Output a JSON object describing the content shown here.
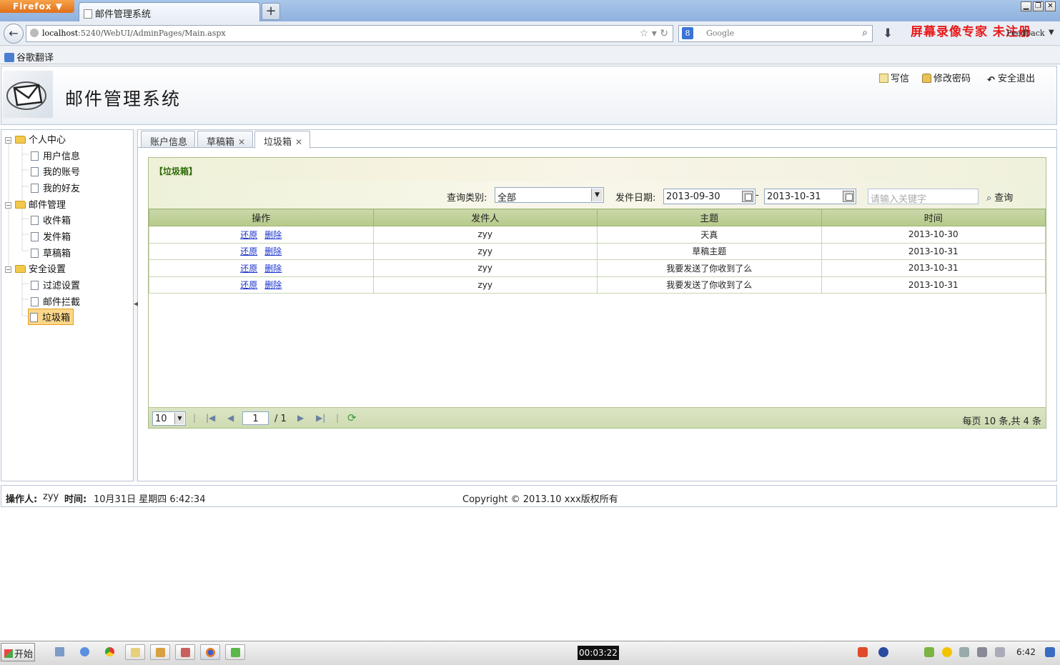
{
  "browser": {
    "menu_button": "Firefox ▼",
    "tab_title": "邮件管理系统",
    "new_tab": "+",
    "url_host": "localhost",
    "url_rest": ":5240/WebUI/AdminPages/Main.aspx",
    "search_placeholder": "Google",
    "feedback": "Feedback",
    "watermark": "屏幕录像专家 未注册",
    "bookmark": "谷歌翻译"
  },
  "app": {
    "title": "邮件管理系统",
    "links": {
      "write": "写信",
      "change_password": "修改密码",
      "logout": "安全退出"
    }
  },
  "sidebar": {
    "groups": [
      {
        "label": "个人中心",
        "items": [
          "用户信息",
          "我的账号",
          "我的好友"
        ]
      },
      {
        "label": "邮件管理",
        "items": [
          "收件箱",
          "发件箱",
          "草稿箱"
        ]
      },
      {
        "label": "安全设置",
        "items": [
          "过滤设置",
          "邮件拦截",
          "垃圾箱"
        ]
      }
    ],
    "selected": "垃圾箱"
  },
  "tabs": [
    {
      "label": "账户信息",
      "closable": false
    },
    {
      "label": "草稿箱",
      "closable": true
    },
    {
      "label": "垃圾箱",
      "closable": true,
      "active": true
    }
  ],
  "panel": {
    "title": "【垃圾箱】",
    "filters": {
      "category_label": "查询类别:",
      "category_value": "全部",
      "date_label": "发件日期:",
      "date_from": "2013-09-30",
      "date_sep": "-",
      "date_to": "2013-10-31",
      "keyword_placeholder": "请输入关键字",
      "search_button": "查询"
    },
    "table": {
      "headers": [
        "操作",
        "发件人",
        "主题",
        "时间"
      ],
      "actions": {
        "restore": "还原",
        "delete": "删除"
      },
      "rows": [
        {
          "sender": "zyy",
          "subject": "天真",
          "time": "2013-10-30"
        },
        {
          "sender": "zyy",
          "subject": "草稿主题",
          "time": "2013-10-31"
        },
        {
          "sender": "zyy",
          "subject": "我要发送了你收到了么",
          "time": "2013-10-31"
        },
        {
          "sender": "zyy",
          "subject": "我要发送了你收到了么",
          "time": "2013-10-31"
        }
      ]
    },
    "pager": {
      "page_size": "10",
      "current_page": "1",
      "total_pages": "/ 1",
      "summary": "每页 10 条,共 4 条"
    }
  },
  "footer": {
    "operator_label": "操作人:",
    "operator": "zyy",
    "time_label": "时间:",
    "time": "10月31日 星期四 6:42:34",
    "copyright": "Copyright © 2013.10 xxx版权所有"
  },
  "taskbar": {
    "start": "开始",
    "recording_time": "00:03:22",
    "clock": "6:42"
  },
  "colors": {
    "panel_header_text": "#2e6b0a",
    "grid_header": "#c2d39f",
    "selected_node": "#fbd78a",
    "watermark": "#e81a1a"
  }
}
